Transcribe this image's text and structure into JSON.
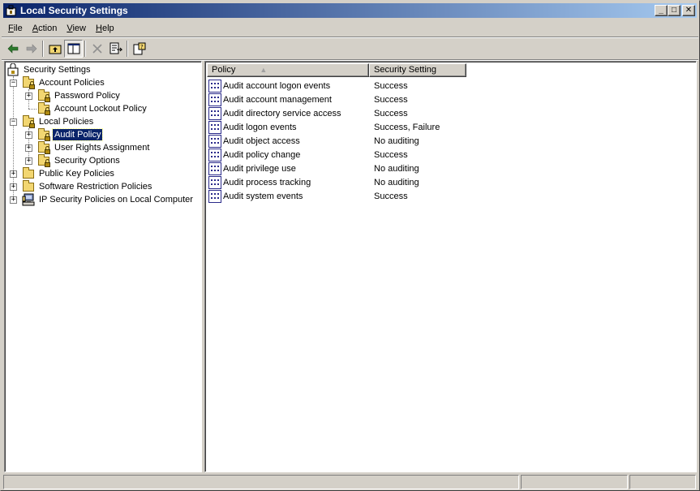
{
  "window": {
    "title": "Local Security Settings"
  },
  "title_buttons": {
    "minimize": "_",
    "maximize": "□",
    "close": "✕"
  },
  "menu": [
    {
      "accel": "F",
      "rest": "ile"
    },
    {
      "accel": "A",
      "rest": "ction"
    },
    {
      "accel": "V",
      "rest": "iew"
    },
    {
      "accel": "H",
      "rest": "elp"
    }
  ],
  "toolbar": {
    "back_icon": "back-arrow-icon",
    "forward_icon": "forward-arrow-icon",
    "up_icon": "up-folder-icon",
    "show_tree_icon": "show-hide-tree-icon",
    "delete_icon": "delete-icon",
    "export_icon": "export-list-icon",
    "help_icon": "help-icon"
  },
  "tree": {
    "root": "Security Settings",
    "account_policies": "Account Policies",
    "password_policy": "Password Policy",
    "account_lockout_policy": "Account Lockout Policy",
    "local_policies": "Local Policies",
    "audit_policy": "Audit Policy",
    "user_rights_assignment": "User Rights Assignment",
    "security_options": "Security Options",
    "public_key_policies": "Public Key Policies",
    "software_restriction_policies": "Software Restriction Policies",
    "ip_security_policies": "IP Security Policies on Local Computer",
    "expand_minus": "−",
    "expand_plus": "+"
  },
  "list": {
    "columns": [
      "Policy",
      "Security Setting"
    ],
    "sort_indicator": "▲",
    "rows": [
      {
        "policy": "Audit account logon events",
        "setting": "Success"
      },
      {
        "policy": "Audit account management",
        "setting": "Success"
      },
      {
        "policy": "Audit directory service access",
        "setting": "Success"
      },
      {
        "policy": "Audit logon events",
        "setting": "Success, Failure"
      },
      {
        "policy": "Audit object access",
        "setting": "No auditing"
      },
      {
        "policy": "Audit policy change",
        "setting": "Success"
      },
      {
        "policy": "Audit privilege use",
        "setting": "No auditing"
      },
      {
        "policy": "Audit process tracking",
        "setting": "No auditing"
      },
      {
        "policy": "Audit system events",
        "setting": "Success"
      }
    ]
  },
  "colors": {
    "titlebar_start": "#0a246a",
    "titlebar_end": "#a6caf0",
    "selection": "#0a246a",
    "face": "#d4d0c8"
  }
}
